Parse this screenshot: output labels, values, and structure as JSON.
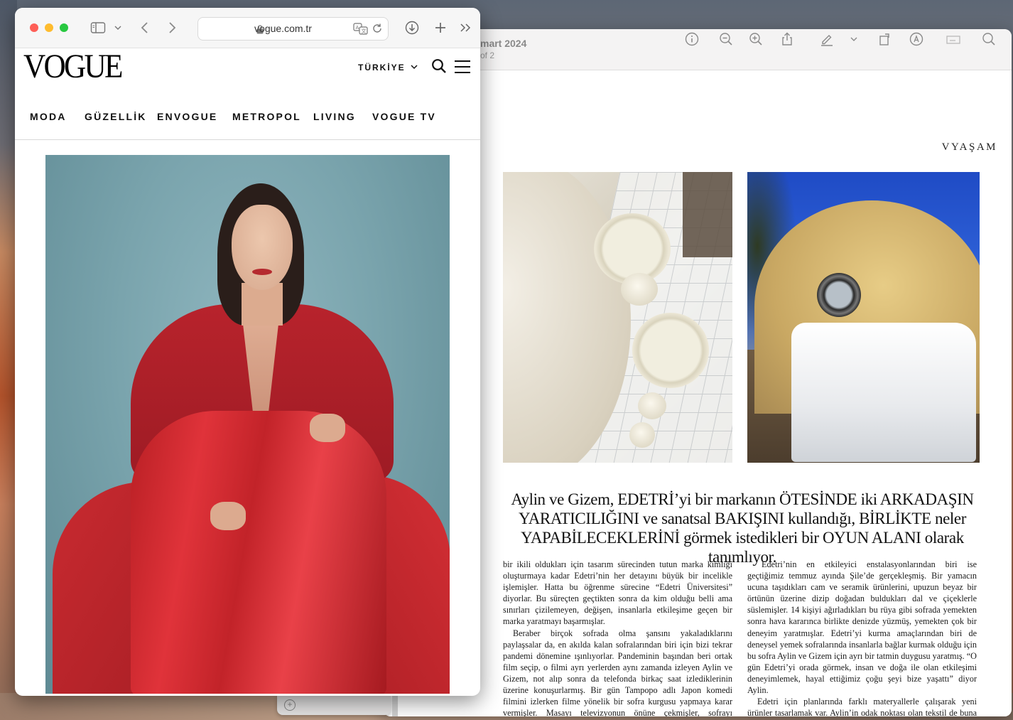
{
  "preview": {
    "title": "mart 2024",
    "subtitle": "of 2",
    "section_label": "VYAŞAM",
    "toolbar_icons": [
      "info-icon",
      "zoom-out-icon",
      "zoom-in-icon",
      "share-icon",
      "markup-pen-icon",
      "chevron-down-icon",
      "rotate-icon",
      "markup-circle-icon",
      "form-icon",
      "search-icon"
    ],
    "headline_lines": [
      "Aylin ve Gizem, EDETRİ’yi bir markanın ÖTESİNDE iki ARKADAŞIN",
      "YARATICILIĞINI ve sanatsal BAKIŞINI kullandığı, BİRLİKTE neler",
      "YAPABİLECEKLERİNİ görmek istedikleri bir OYUN ALANI olarak tanımlıyor."
    ],
    "column1": [
      "bir ikili oldukları için tasarım sürecinden tutun marka kimliği oluşturmaya kadar Edetri’nin her detayını büyük bir incelikle işlemişler. Hatta bu öğrenme sürecine “Edetri Üniversitesi” diyorlar. Bu süreçten geçtikten sonra da kim olduğu belli ama sınırları çizilemeyen, değişen, insanlarla etkileşime geçen bir marka yaratmayı başarmışlar.",
      "Beraber birçok sofrada olma şansını yakaladıklarını paylaşsalar da, en akılda kalan sofralarından biri için bizi tekrar pandemi dönemine ışınlıyorlar. Pandeminin başından beri ortak film seçip, o filmi ayrı yerlerden aynı zamanda izleyen Aylin ve Gizem, not alıp sonra da telefonda birkaç saat izlediklerinin üzerine konuşurlarmış. Bir gün Tampopo adlı Japon komedi filmini izlerken filme yönelik bir sofra kurgusu yapmaya karar vermişler. Masayı televizyonun önüne çekmişler, sofrayı kurmuşlar. O kurguyu oluşturmak çok hoşlarına gitmiş. Hatta sofrayı"
    ],
    "column2": [
      "Edetri’nin en etkileyici enstalasyonlarından biri ise geçtiğimiz temmuz ayında Şile’de gerçekleşmiş. Bir yamacın ucuna taşıdıkları cam ve seramik ürünlerini, upuzun beyaz bir örtünün üzerine dizip doğadan buldukları dal ve çiçeklerle süslemişler. 14 kişiyi ağırladıkları bu rüya gibi sofrada yemekten sonra hava kararınca birlikte denizde yüzmüş, yemekten çok bir deneyim yaratmışlar. Edetri’yi kurma amaçlarından biri de deneysel yemek sofralarında insanlarla bağlar kurmak olduğu için bu sofra Aylin ve Gizem için ayrı bir tatmin duygusu yaratmış. “O gün Edetri’yi orada görmek, insan ve doğa ile olan etkileşimi deneyimlemek, hayal ettiğimiz çoğu şeyi bize yaşattı” diyor Aylin.",
      "Edetri için planlarında farklı materyallerle çalışarak yeni ürünler tasarlamak var. Aylin’in odak noktası olan tekstil de buna dahil. Aynı zamanda sanatsal taraflarına daha çok"
    ]
  },
  "safari": {
    "url": "vogue.com.tr",
    "toolbar_icons": [
      "sidebar-icon",
      "chevron-down-icon",
      "back-icon",
      "forward-icon",
      "translate-icon",
      "reload-icon",
      "download-icon",
      "new-tab-icon",
      "more-chevrons-icon"
    ],
    "traffic_colors": {
      "close": "#fe5f57",
      "minimize": "#febc2e",
      "zoom": "#28c840"
    }
  },
  "vogue": {
    "logo": "VOGUE",
    "region": "TÜRKİYE",
    "nav": [
      "MODA",
      "GÜZELLİK",
      "ENVOGUE",
      "METROPOL",
      "LIVING",
      "VOGUE TV"
    ]
  },
  "colors": {
    "accent_red": "#b8232c",
    "backdrop_teal": "#7aa4ad"
  }
}
